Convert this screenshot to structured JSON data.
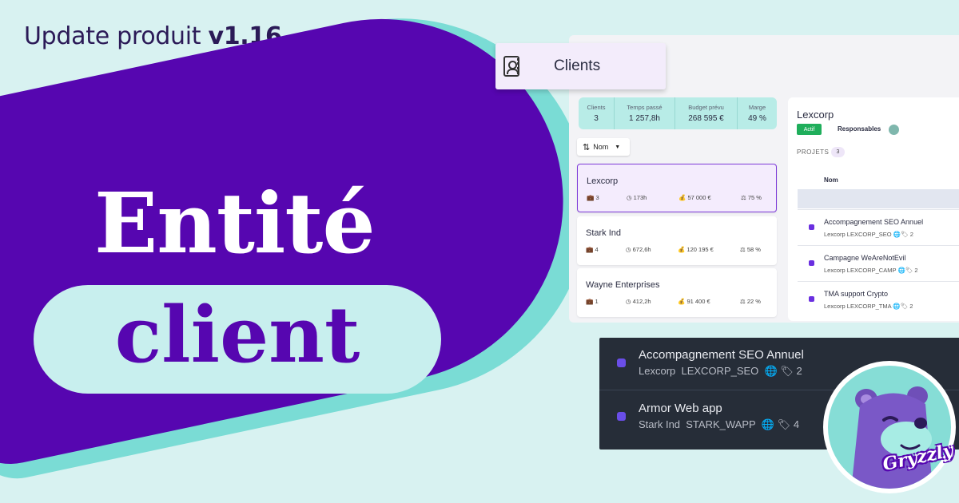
{
  "header": {
    "update_label": "Update produit",
    "version": "v1.16"
  },
  "hero": {
    "line1": "Entité",
    "line2": "client"
  },
  "app": {
    "section_tab": "Clients",
    "stats": [
      {
        "label": "Clients",
        "value": "3"
      },
      {
        "label": "Temps passé",
        "value": "1 257,8h"
      },
      {
        "label": "Budget prévu",
        "value": "268 595 €"
      },
      {
        "label": "Marge",
        "value": "49 %"
      }
    ],
    "sort": {
      "label": "Nom"
    },
    "clients": [
      {
        "name": "Lexcorp",
        "projects": "3",
        "time": "173h",
        "budget": "57 000 €",
        "margin": "75 %",
        "selected": true
      },
      {
        "name": "Stark Ind",
        "projects": "4",
        "time": "672,6h",
        "budget": "120 195 €",
        "margin": "58 %",
        "selected": false
      },
      {
        "name": "Wayne Enterprises",
        "projects": "1",
        "time": "412,2h",
        "budget": "91 400 €",
        "margin": "22 %",
        "selected": false
      }
    ],
    "detail": {
      "name": "Lexcorp",
      "status": "Actif",
      "responsables_label": "Responsables",
      "projets_label": "PROJETS",
      "projets_count": "3",
      "col_nom": "Nom",
      "projects": [
        {
          "name": "Accompagnement SEO Annuel",
          "client": "Lexcorp",
          "code": "LEXCORP_SEO",
          "tags": "2"
        },
        {
          "name": "Campagne WeAreNotEvil",
          "client": "Lexcorp",
          "code": "LEXCORP_CAMP",
          "tags": "2"
        },
        {
          "name": "TMA support Crypto",
          "client": "Lexcorp",
          "code": "LEXCORP_TMA",
          "tags": "2"
        }
      ]
    }
  },
  "dark_list": [
    {
      "name": "Accompagnement SEO Annuel",
      "client": "Lexcorp",
      "code": "LEXCORP_SEO",
      "tags": "2"
    },
    {
      "name": "Armor Web app",
      "client": "Stark Ind",
      "code": "STARK_WAPP",
      "tags": "4"
    }
  ],
  "brand": {
    "logo_text": "Gryzzly"
  },
  "colors": {
    "background": "#d8f2f1",
    "primary_purple": "#5606b0",
    "teal": "#7adcd5",
    "dark_panel": "#262d38",
    "active_green": "#1fae5b"
  },
  "icons": {
    "clients_tab": "contact-book-icon",
    "sort": "sort-ascending-icon",
    "projects": "briefcase-icon",
    "time": "clock-icon",
    "budget": "money-bag-icon",
    "margin": "scale-icon",
    "web": "globe-icon",
    "tags": "tag-icon"
  }
}
